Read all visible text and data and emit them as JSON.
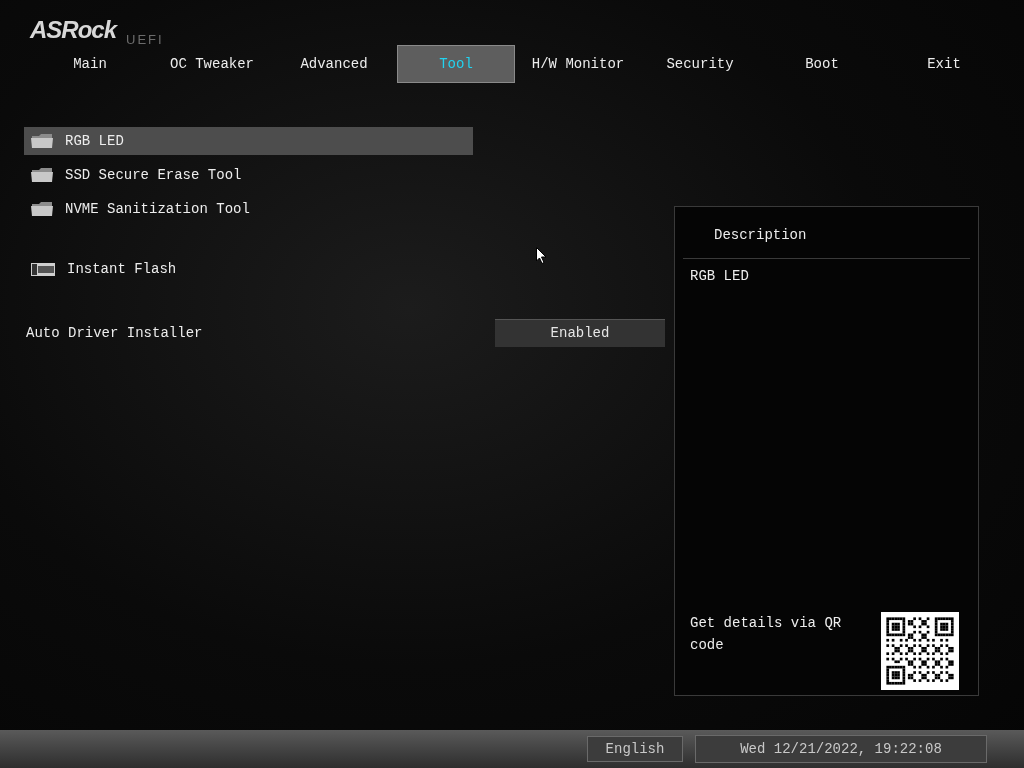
{
  "logo": {
    "brand": "ASRock",
    "sub": "UEFI"
  },
  "tabs": [
    {
      "label": "Main",
      "selected": false
    },
    {
      "label": "OC Tweaker",
      "selected": false
    },
    {
      "label": "Advanced",
      "selected": false
    },
    {
      "label": "Tool",
      "selected": true
    },
    {
      "label": "H/W Monitor",
      "selected": false
    },
    {
      "label": "Security",
      "selected": false
    },
    {
      "label": "Boot",
      "selected": false
    },
    {
      "label": "Exit",
      "selected": false
    }
  ],
  "items": [
    {
      "kind": "folder",
      "label": "RGB LED",
      "selected": true
    },
    {
      "kind": "folder",
      "label": "SSD Secure Erase Tool",
      "selected": false
    },
    {
      "kind": "folder",
      "label": "NVME Sanitization Tool",
      "selected": false
    },
    {
      "kind": "bios",
      "label": "Instant Flash",
      "selected": false
    },
    {
      "kind": "setting",
      "label": "Auto Driver Installer",
      "value": "Enabled",
      "selected": false
    }
  ],
  "description": {
    "title": "Description",
    "text": "RGB LED",
    "qr_text": "Get details via QR code"
  },
  "status_bar": {
    "language": "English",
    "datetime": "Wed 12/21/2022, 19:22:08"
  }
}
